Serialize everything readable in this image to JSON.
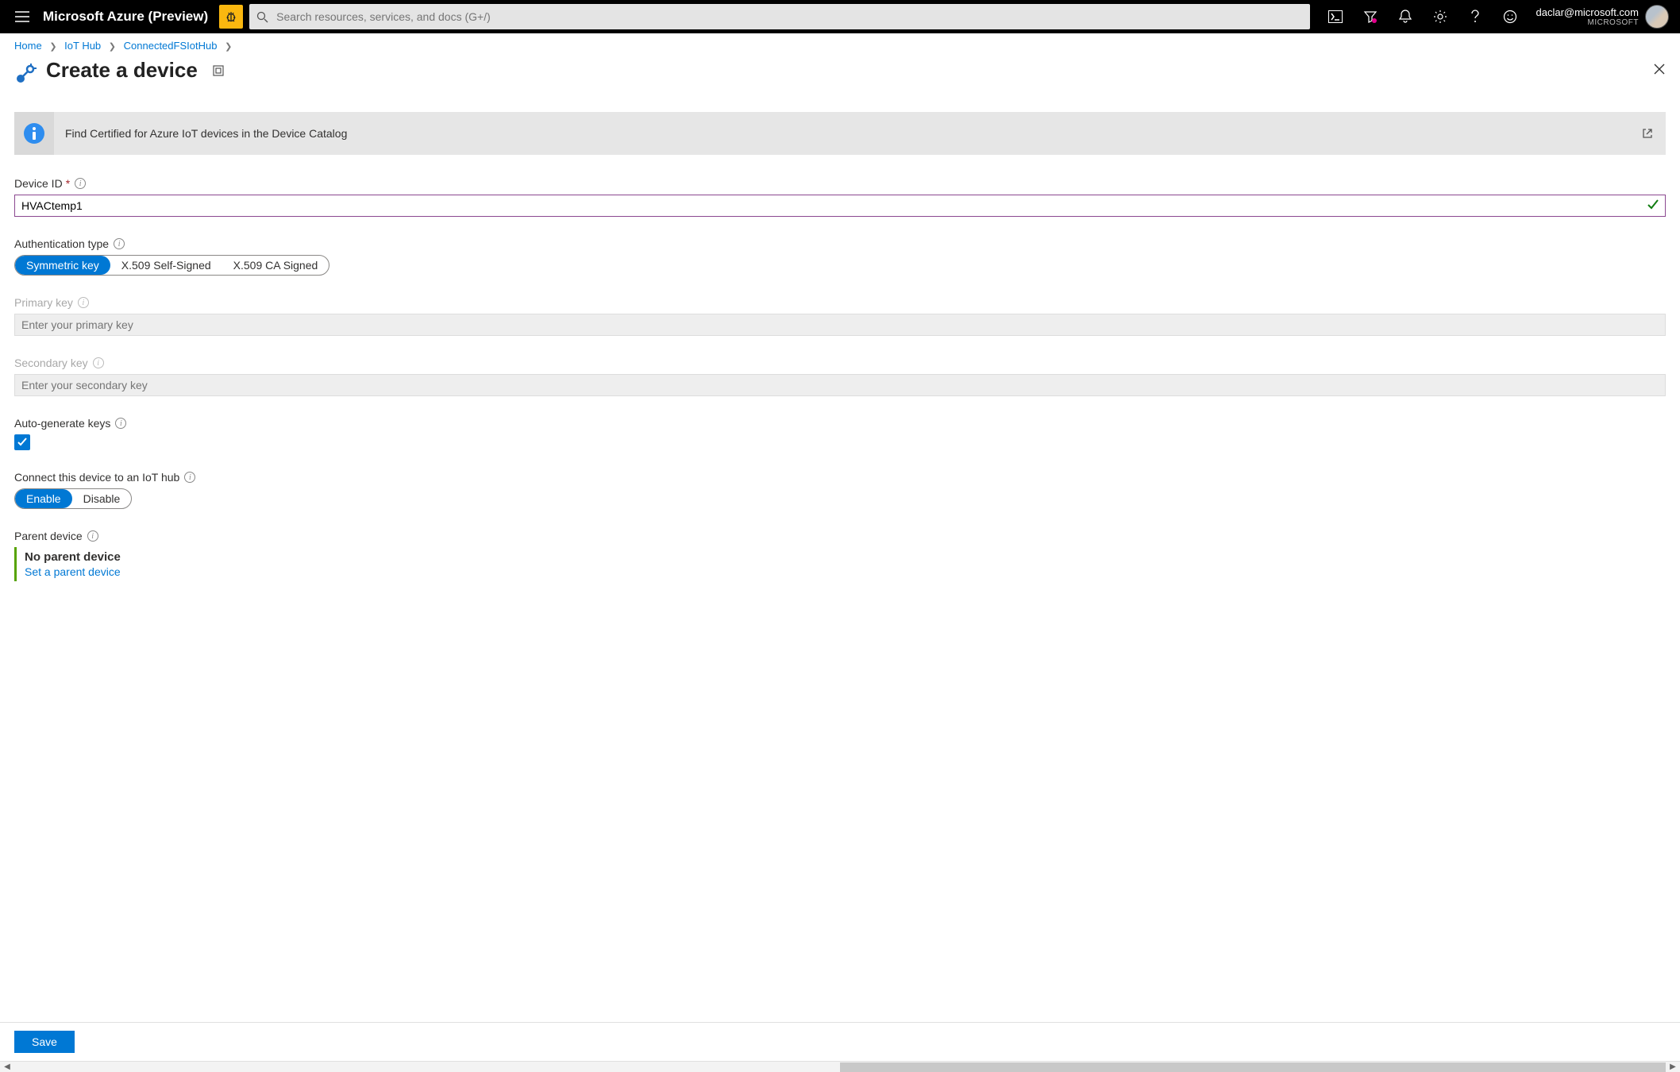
{
  "brand": "Microsoft Azure (Preview)",
  "search_placeholder": "Search resources, services, and docs (G+/)",
  "account": {
    "email": "daclar@microsoft.com",
    "tenant": "MICROSOFT"
  },
  "breadcrumbs": {
    "b0": "Home",
    "b1": "IoT Hub",
    "b2": "ConnectedFSIotHub"
  },
  "blade_title": "Create a device",
  "info_banner": "Find Certified for Azure IoT devices in the Device Catalog",
  "fields": {
    "device_id": {
      "label": "Device ID",
      "value": "HVACtemp1"
    },
    "auth_type": {
      "label": "Authentication type",
      "opt0": "Symmetric key",
      "opt1": "X.509 Self-Signed",
      "opt2": "X.509 CA Signed",
      "selected": "Symmetric key"
    },
    "primary_key": {
      "label": "Primary key",
      "placeholder": "Enter your primary key"
    },
    "secondary_key": {
      "label": "Secondary key",
      "placeholder": "Enter your secondary key"
    },
    "autogen": {
      "label": "Auto-generate keys",
      "checked": true
    },
    "connect": {
      "label": "Connect this device to an IoT hub",
      "opt0": "Enable",
      "opt1": "Disable",
      "selected": "Enable"
    },
    "parent": {
      "label": "Parent device",
      "value": "No parent device",
      "link": "Set a parent device"
    }
  },
  "footer": {
    "save": "Save"
  }
}
